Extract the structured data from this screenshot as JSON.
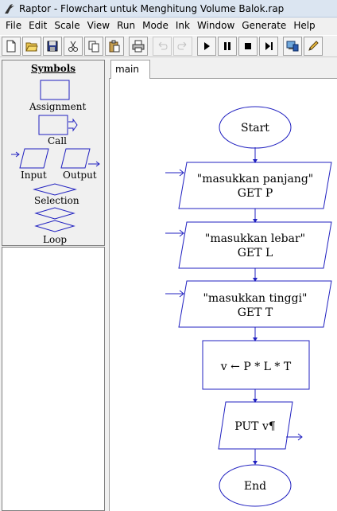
{
  "window": {
    "title": "Raptor - Flowchart untuk Menghitung Volume Balok.rap"
  },
  "menu": [
    "File",
    "Edit",
    "Scale",
    "View",
    "Run",
    "Mode",
    "Ink",
    "Window",
    "Generate",
    "Help"
  ],
  "toolbar": {
    "buttons": [
      {
        "name": "new-file-button",
        "icon": "new-file-icon"
      },
      {
        "name": "open-button",
        "icon": "open-folder-icon"
      },
      {
        "name": "save-button",
        "icon": "save-icon"
      },
      {
        "name": "cut-button",
        "icon": "cut-icon"
      },
      {
        "name": "copy-button",
        "icon": "copy-icon"
      },
      {
        "name": "paste-button",
        "icon": "paste-icon"
      },
      {
        "name": "print-button",
        "icon": "print-icon"
      },
      {
        "name": "undo-button",
        "icon": "undo-icon",
        "disabled": true
      },
      {
        "name": "redo-button",
        "icon": "redo-icon",
        "disabled": true
      },
      {
        "name": "run-button",
        "icon": "play-icon"
      },
      {
        "name": "pause-button",
        "icon": "pause-icon"
      },
      {
        "name": "stop-button",
        "icon": "stop-icon"
      },
      {
        "name": "step-button",
        "icon": "step-icon"
      },
      {
        "name": "monitor-button",
        "icon": "monitor-icon"
      },
      {
        "name": "pen-button",
        "icon": "pencil-icon"
      }
    ]
  },
  "symbols": {
    "title": "Symbols",
    "assignment": "Assignment",
    "call": "Call",
    "input": "Input",
    "output": "Output",
    "selection": "Selection",
    "loop": "Loop"
  },
  "tabs": [
    {
      "label": "main"
    }
  ],
  "flowchart": {
    "start": "Start",
    "input1_line1": "\"masukkan panjang\"",
    "input1_line2": "GET P",
    "input2_line1": "\"masukkan lebar\"",
    "input2_line2": "GET L",
    "input3_line1": "\"masukkan tinggi\"",
    "input3_line2": "GET T",
    "assign": "v ← P * L * T",
    "output": "PUT v¶",
    "end": "End"
  },
  "colors": {
    "flow_stroke": "#2020c0",
    "panel_border": "#808080"
  }
}
